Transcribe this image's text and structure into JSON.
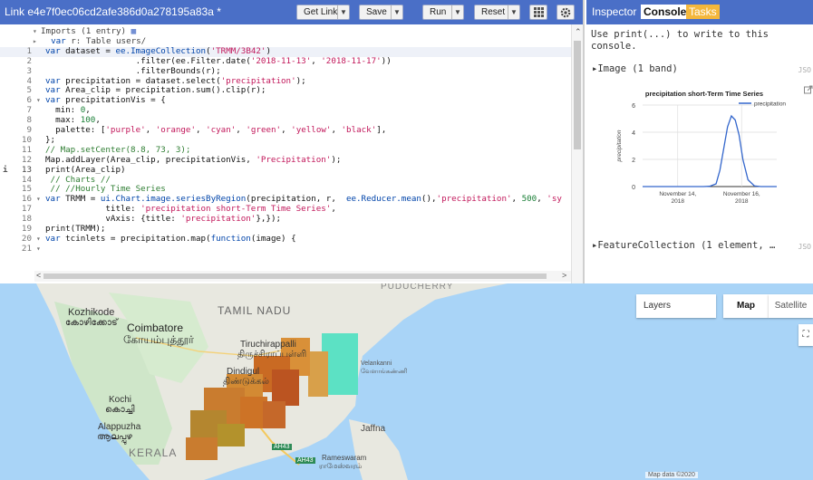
{
  "editor": {
    "title": "Link e4e7f0ec06cd2afe386d0a278195a83a *",
    "buttons": {
      "get_link": "Get Link",
      "save": "Save",
      "run": "Run",
      "reset": "Reset"
    },
    "lines": [
      {
        "n": "",
        "fold": "▾",
        "html": "<span class='imp'>Imports (1 entry) </span><span style='color:#4a6fc7'>&#9638;</span>"
      },
      {
        "n": "",
        "fold": "▸",
        "html": "<span class='imp'>&nbsp;&nbsp;<span class='kw'>var</span> r: Table users/</span>"
      },
      {
        "n": "1",
        "html": "<span class='kw'>var</span> dataset = <span class='kw'>ee.ImageCollection</span>(<span class='str'>'TRMM/3B42'</span>)",
        "active": true
      },
      {
        "n": "2",
        "html": "                  .filter(ee.Filter.date(<span class='str'>'2018-11-13'</span>, <span class='str'>'2018-11-17'</span>))"
      },
      {
        "n": "3",
        "html": "                  .filterBounds(r);"
      },
      {
        "n": "4",
        "html": "<span class='kw'>var</span> precipitation = dataset.select(<span class='str'>'precipitation'</span>);"
      },
      {
        "n": "5",
        "html": "<span class='kw'>var</span> Area_clip = precipitation.sum().clip(r);"
      },
      {
        "n": "6",
        "fold": "▾",
        "html": "<span class='kw'>var</span> precipitationVis = {"
      },
      {
        "n": "7",
        "html": "  min: <span class='num'>0</span>,"
      },
      {
        "n": "8",
        "html": "  max: <span class='num'>100</span>,"
      },
      {
        "n": "9",
        "html": "  palette: [<span class='str'>'purple'</span>, <span class='str'>'orange'</span>, <span class='str'>'cyan'</span>, <span class='str'>'green'</span>, <span class='str'>'yellow'</span>, <span class='str'>'black'</span>],"
      },
      {
        "n": "10",
        "html": "};"
      },
      {
        "n": "11",
        "html": "<span class='cm'>// Map.setCenter(8.8, 73, 3);</span>"
      },
      {
        "n": "12",
        "html": "Map.addLayer(Area_clip, precipitationVis, <span class='str'>'Precipitation'</span>);"
      },
      {
        "n": "13",
        "warn": true,
        "html": "print(Area_clip)"
      },
      {
        "n": "14",
        "html": " <span class='cm'>// Charts //</span>"
      },
      {
        "n": "15",
        "html": " <span class='cm'>// //Hourly Time Series</span>"
      },
      {
        "n": "16",
        "fold": "▾",
        "html": "<span class='kw'>var</span> TRMM = <span class='kw'>ui.Chart.image.seriesByRegion</span>(precipitation, r,  <span class='kw'>ee.Reducer.mean</span>(),<span class='str'>'precipitation'</span>, <span class='num'>500</span>, <span class='str'>'sy</span>"
      },
      {
        "n": "17",
        "html": "            title: <span class='str'>'precipitation short-Term Time Series'</span>,"
      },
      {
        "n": "18",
        "html": "            vAxis: {title: <span class='str'>'precipitation'</span>},});"
      },
      {
        "n": "19",
        "html": "print(TRMM);"
      },
      {
        "n": "20",
        "fold": "▾",
        "html": "<span class='kw'>var</span> tcinlets = precipitation.map(<span class='kw'>function</span>(image) {"
      },
      {
        "n": "21",
        "fold": "▾",
        "html": ""
      }
    ]
  },
  "side": {
    "tabs": {
      "inspector": "Inspector",
      "console": "Console",
      "tasks": "Tasks"
    },
    "console_hint": "Use print(...) to write to this console.",
    "image_entry": "▸Image (1 band)",
    "json_label": "JSO",
    "feature_entry": "▸FeatureCollection (1 element, …",
    "json_label2": "JSO"
  },
  "chart_data": {
    "type": "line",
    "title": "precipitation short-Term Time Series",
    "ylabel": "precipitation",
    "xlabel": "",
    "ylim": [
      0,
      6
    ],
    "yticks": [
      0,
      2,
      4,
      6
    ],
    "xticks": [
      {
        "x": 1.0,
        "line1": "November 14,",
        "line2": "2018"
      },
      {
        "x": 2.0,
        "line1": "November 16,",
        "line2": "2018"
      }
    ],
    "xlim": [
      0.45,
      2.55
    ],
    "series": [
      {
        "name": "precipitation",
        "color": "#3366cc",
        "x": [
          0.45,
          0.6,
          0.8,
          1.0,
          1.2,
          1.4,
          1.5,
          1.6,
          1.66,
          1.72,
          1.78,
          1.84,
          1.9,
          1.96,
          2.02,
          2.1,
          2.2,
          2.3,
          2.4,
          2.55
        ],
        "values": [
          0,
          0,
          0,
          0,
          0,
          0,
          0.02,
          0.2,
          1.2,
          2.8,
          4.4,
          5.2,
          4.9,
          3.8,
          2.0,
          0.5,
          0.05,
          0,
          0,
          0
        ]
      }
    ]
  },
  "map": {
    "labels": {
      "kozhikode": "Kozhikode",
      "kozhikode_local": "കോഴിക്കോട്",
      "coimbatore": "Coimbatore",
      "coimbatore_local": "கோயம்புத்தூர்",
      "tamilnadu": "TAMIL NADU",
      "tiruchirappalli": "Tiruchirappalli",
      "tiruchirappalli_local": "திருச்சிராப்பள்ளி",
      "dindigul": "Dindigul",
      "dindigul_local": "திண்டுக்கல்",
      "kochi": "Kochi",
      "kochi_local": "കൊച്ചി",
      "alappuzha": "Alappuzha",
      "alappuzha_local": "ആലപ്പുഴ",
      "kerala": "KERALA",
      "jaffna": "Jaffna",
      "velankanni": "Velankanni",
      "velankanni_local": "வேளாங்கண்ணி",
      "rameswaram": "Rameswaram",
      "rameswaram_local": "ராமேஸ்வரம்",
      "pondicherry": "PUDUCHERRY",
      "ah43": "AH43",
      "ah43b": "AH43"
    },
    "controls": {
      "layers": "Layers",
      "map": "Map",
      "satellite": "Satellite"
    },
    "footer": "Map data ©2020"
  }
}
